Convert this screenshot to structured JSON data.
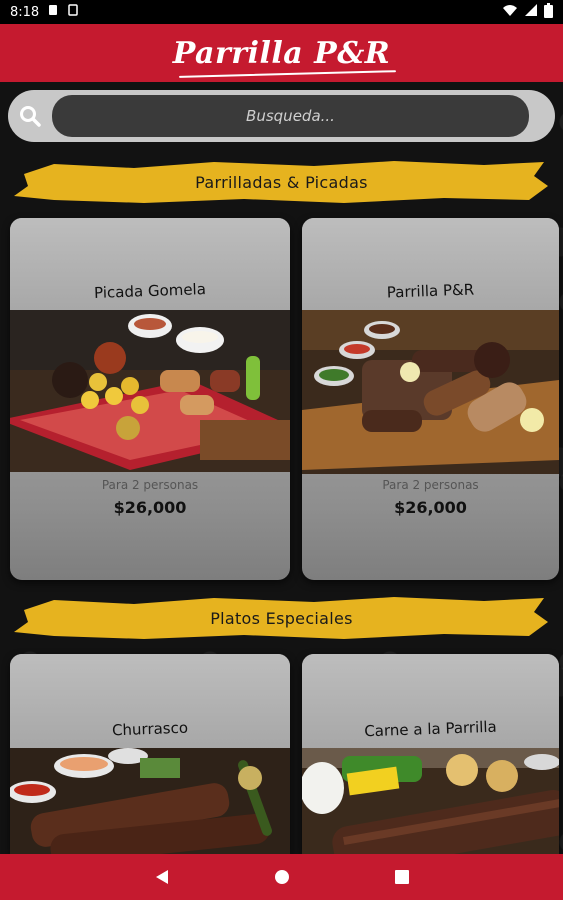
{
  "status": {
    "time": "8:18"
  },
  "app": {
    "logo": "Parrilla P&R"
  },
  "search": {
    "placeholder": "Busqueda..."
  },
  "sections": [
    {
      "title": "Parrilladas & Picadas",
      "items": [
        {
          "name": "Picada Gomela",
          "subtitle": "Para 2 personas",
          "price": "$26,000"
        },
        {
          "name": "Parrilla P&R",
          "subtitle": "Para 2 personas",
          "price": "$26,000"
        }
      ]
    },
    {
      "title": "Platos Especiales",
      "items": [
        {
          "name": "Churrasco"
        },
        {
          "name": "Carne a la Parrilla"
        }
      ]
    }
  ],
  "colors": {
    "brand_red": "#c51a2f",
    "banner_yellow": "#e6b31f",
    "card_gray": "#a8a8a8"
  },
  "icons": [
    "search-icon",
    "back-icon",
    "home-icon",
    "recents-icon",
    "wifi-icon",
    "signal-icon",
    "battery-icon"
  ]
}
